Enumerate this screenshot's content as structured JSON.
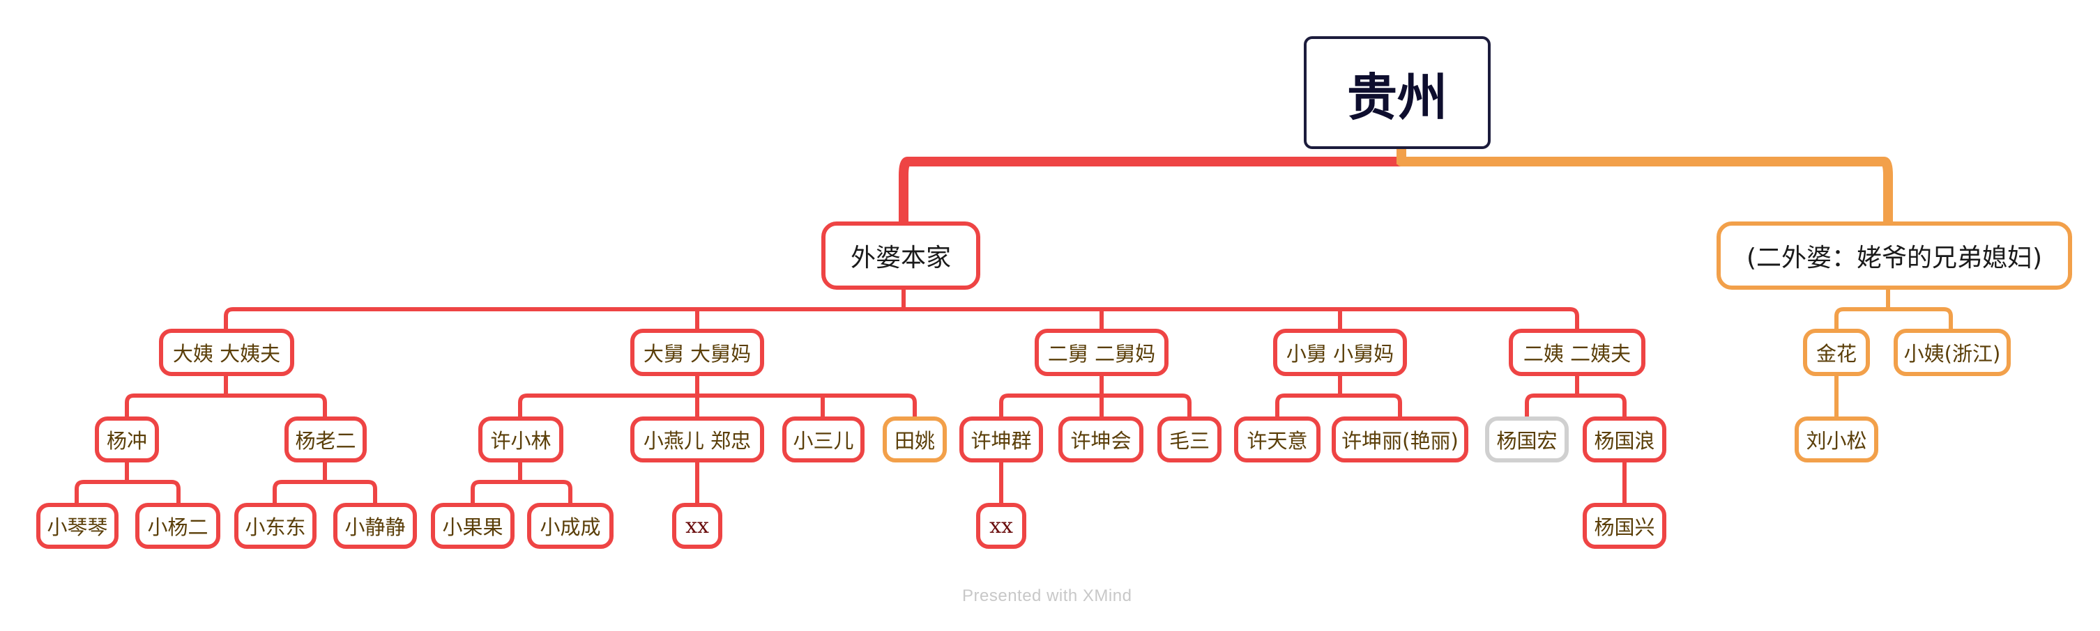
{
  "root": {
    "label": "贵州"
  },
  "branches": {
    "waipo": {
      "label": "外婆本家"
    },
    "er_waipo": {
      "label": "(二外婆：姥爷的兄弟媳妇)"
    }
  },
  "nodes": {
    "dayi": "大姨  大姨夫",
    "dajiu": "大舅 大舅妈",
    "erjiu": "二舅  二舅妈",
    "xiaojiu": "小舅  小舅妈",
    "eryi": "二姨  二姨夫",
    "jinhua": "金花",
    "xiaoyi_zj": "小姨(浙江)",
    "yangchong": "杨冲",
    "yanglaoer": "杨老二",
    "xuxiaolin": "许小林",
    "xiaoyaner": "小燕儿   郑忠",
    "xiaosaner": "小三儿",
    "tianyao": "田姚",
    "xukunqun": "许坤群",
    "xukunhui": "许坤会",
    "maosan": "毛三",
    "xutianyi": "许天意",
    "xukunli": "许坤丽(艳丽)",
    "yangguohong": "杨国宏",
    "yangguolang": "杨国浪",
    "liuxiaosong": "刘小松",
    "xiaoqinqin": "小琴琴",
    "xiaoyanger": "小杨二",
    "xiaodongdong": "小东东",
    "xiaojingjing": "小静静",
    "xiaoguoguo": "小果果",
    "xiaochengcheng": "小成成",
    "xx1": "xx",
    "xx2": "xx",
    "yangguoxing": "杨国兴"
  },
  "colors": {
    "primary_line": "#ee4444",
    "secondary_line": "#f2a04a",
    "inactive_border": "#d0d0d0",
    "root_border": "#1c1c3c"
  },
  "footer": {
    "text": "Presented with XMind"
  }
}
